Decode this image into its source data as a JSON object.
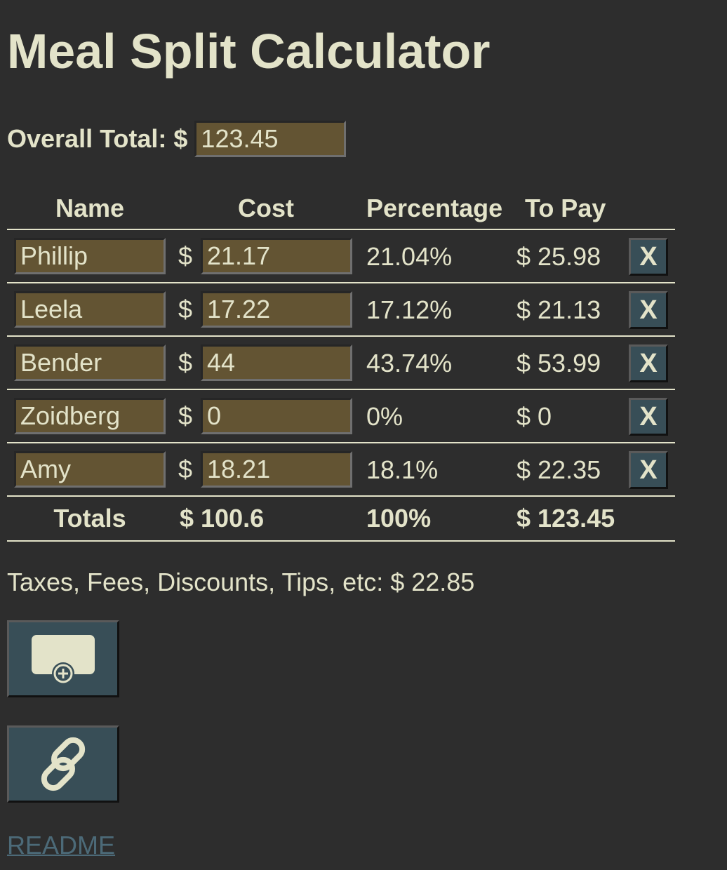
{
  "title": "Meal Split Calculator",
  "overall": {
    "label": "Overall Total:",
    "currency": "$",
    "value": "123.45"
  },
  "table": {
    "headers": {
      "name": "Name",
      "cost": "Cost",
      "percentage": "Percentage",
      "to_pay": "To Pay"
    },
    "rows": [
      {
        "name": "Phillip",
        "currency": "$",
        "cost": "21.17",
        "percentage": "21.04%",
        "to_pay": "$ 25.98",
        "remove_label": "X"
      },
      {
        "name": "Leela",
        "currency": "$",
        "cost": "17.22",
        "percentage": "17.12%",
        "to_pay": "$ 21.13",
        "remove_label": "X"
      },
      {
        "name": "Bender",
        "currency": "$",
        "cost": "44",
        "percentage": "43.74%",
        "to_pay": "$ 53.99",
        "remove_label": "X"
      },
      {
        "name": "Zoidberg",
        "currency": "$",
        "cost": "0",
        "percentage": "0%",
        "to_pay": "$ 0",
        "remove_label": "X"
      },
      {
        "name": "Amy",
        "currency": "$",
        "cost": "18.21",
        "percentage": "18.1%",
        "to_pay": "$ 22.35",
        "remove_label": "X"
      }
    ],
    "totals": {
      "label": "Totals",
      "cost": "$ 100.6",
      "percentage": "100%",
      "to_pay": "$ 123.45"
    }
  },
  "extras": {
    "text": "Taxes, Fees, Discounts, Tips, etc: $ 22.85"
  },
  "buttons": {
    "add_row_icon": "add-row-icon",
    "share_link_icon": "link-icon"
  },
  "readme": {
    "label": "README"
  },
  "colors": {
    "background": "#2d2d2d",
    "text": "#e3e3c9",
    "input_bg": "#635433",
    "button_bg": "#384e57",
    "link": "#4c6a78"
  }
}
